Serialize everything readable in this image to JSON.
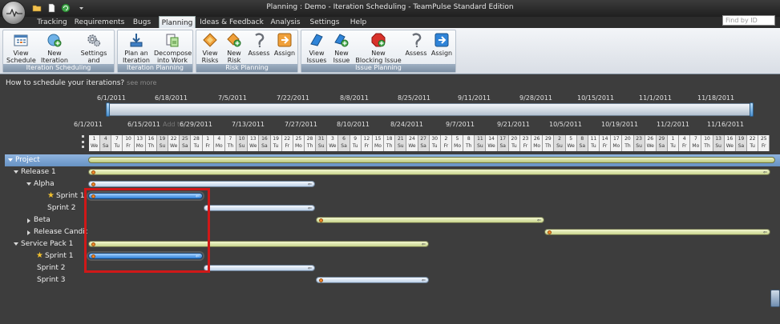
{
  "window": {
    "title": "Planning : Demo - Iteration Scheduling  - TeamPulse Standard Edition",
    "find_placeholder": "Find by ID"
  },
  "tabs": [
    {
      "label": "Tracking"
    },
    {
      "label": "Requirements"
    },
    {
      "label": "Bugs"
    },
    {
      "label": "Planning",
      "active": true
    },
    {
      "label": "Ideas & Feedback"
    },
    {
      "label": "Analysis"
    },
    {
      "label": "Settings"
    },
    {
      "label": "Help"
    }
  ],
  "ribbon": {
    "groups": [
      {
        "label": "Iteration Scheduling",
        "buttons": [
          {
            "line1": "View",
            "line2": "Schedule",
            "icon": "calendar-icon"
          },
          {
            "line1": "New",
            "line2": "Iteration",
            "icon": "add-iteration-icon"
          },
          {
            "line1": "Settings",
            "line2": "and Defaults",
            "icon": "gears-icon"
          }
        ]
      },
      {
        "label": "Iteration Planning",
        "buttons": [
          {
            "line1": "Plan an",
            "line2": "Iteration",
            "icon": "download-tray-icon"
          },
          {
            "line1": "Decompose",
            "line2": "into Work",
            "icon": "decompose-icon"
          }
        ]
      },
      {
        "label": "Risk Planning",
        "buttons": [
          {
            "line1": "View",
            "line2": "Risks",
            "icon": "risk-diamond-icon"
          },
          {
            "line1": "New",
            "line2": "Risk",
            "icon": "new-risk-icon"
          },
          {
            "line1": "Assess",
            "line2": "",
            "icon": "assess-icon"
          },
          {
            "line1": "Assign",
            "line2": "",
            "icon": "assign-arrow-icon"
          }
        ]
      },
      {
        "label": "Issue Planning",
        "buttons": [
          {
            "line1": "View",
            "line2": "Issues",
            "icon": "issues-flag-icon"
          },
          {
            "line1": "New",
            "line2": "Issue",
            "icon": "new-issue-icon"
          },
          {
            "line1": "New",
            "line2": "Blocking Issue",
            "icon": "stop-sign-icon"
          },
          {
            "line1": "Assess",
            "line2": "",
            "icon": "assess-icon"
          },
          {
            "line1": "Assign",
            "line2": "",
            "icon": "assign-arrow-icon"
          }
        ]
      }
    ]
  },
  "schedule": {
    "howto": "How to schedule your iterations?",
    "see_more": "see more",
    "overview_dates": [
      "6/1/2011",
      "6/18/2011",
      "7/5/2011",
      "7/22/2011",
      "8/8/2011",
      "8/25/2011",
      "9/11/2011",
      "9/28/2011",
      "10/15/2011",
      "11/1/2011",
      "11/18/2011"
    ],
    "timeline_dates": [
      "6/1/2011",
      "6/15/2011",
      "6/29/2011",
      "7/13/2011",
      "7/27/2011",
      "8/10/2011",
      "8/24/2011",
      "9/7/2011",
      "9/21/2011",
      "10/5/2011",
      "10/19/2011",
      "11/2/2011",
      "11/16/2011"
    ],
    "ghost_text": "Add to",
    "days": [
      {
        "n": "1",
        "d": "We"
      },
      {
        "n": "4",
        "d": "Sa"
      },
      {
        "n": "7",
        "d": "Tu"
      },
      {
        "n": "10",
        "d": "Fr"
      },
      {
        "n": "13",
        "d": "Mo"
      },
      {
        "n": "16",
        "d": "Th"
      },
      {
        "n": "19",
        "d": "Su"
      },
      {
        "n": "22",
        "d": "We"
      },
      {
        "n": "25",
        "d": "Sa"
      },
      {
        "n": "28",
        "d": "Tu"
      },
      {
        "n": "1",
        "d": "Fr"
      },
      {
        "n": "4",
        "d": "Mo"
      },
      {
        "n": "7",
        "d": "Th"
      },
      {
        "n": "10",
        "d": "Su"
      },
      {
        "n": "13",
        "d": "We"
      },
      {
        "n": "16",
        "d": "Sa"
      },
      {
        "n": "19",
        "d": "Tu"
      },
      {
        "n": "22",
        "d": "Fr"
      },
      {
        "n": "25",
        "d": "Mo"
      },
      {
        "n": "28",
        "d": "Th"
      },
      {
        "n": "31",
        "d": "Su"
      },
      {
        "n": "3",
        "d": "We"
      },
      {
        "n": "6",
        "d": "Sa"
      },
      {
        "n": "9",
        "d": "Tu"
      },
      {
        "n": "12",
        "d": "Fr"
      },
      {
        "n": "15",
        "d": "Mo"
      },
      {
        "n": "18",
        "d": "Th"
      },
      {
        "n": "21",
        "d": "Su"
      },
      {
        "n": "24",
        "d": "We"
      },
      {
        "n": "27",
        "d": "Sa"
      },
      {
        "n": "30",
        "d": "Tu"
      },
      {
        "n": "2",
        "d": "Fr"
      },
      {
        "n": "5",
        "d": "Mo"
      },
      {
        "n": "8",
        "d": "Th"
      },
      {
        "n": "11",
        "d": "Su"
      },
      {
        "n": "14",
        "d": "We"
      },
      {
        "n": "17",
        "d": "Sa"
      },
      {
        "n": "20",
        "d": "Tu"
      },
      {
        "n": "23",
        "d": "Fr"
      },
      {
        "n": "26",
        "d": "Mo"
      },
      {
        "n": "29",
        "d": "Th"
      },
      {
        "n": "2",
        "d": "Su"
      },
      {
        "n": "5",
        "d": "We"
      },
      {
        "n": "8",
        "d": "Sa"
      },
      {
        "n": "11",
        "d": "Tu"
      },
      {
        "n": "14",
        "d": "Fr"
      },
      {
        "n": "17",
        "d": "Mo"
      },
      {
        "n": "20",
        "d": "Th"
      },
      {
        "n": "23",
        "d": "Su"
      },
      {
        "n": "26",
        "d": "We"
      },
      {
        "n": "29",
        "d": "Sa"
      },
      {
        "n": "1",
        "d": "Tu"
      },
      {
        "n": "4",
        "d": "Fr"
      },
      {
        "n": "7",
        "d": "Mo"
      },
      {
        "n": "10",
        "d": "Th"
      },
      {
        "n": "13",
        "d": "Su"
      },
      {
        "n": "16",
        "d": "We"
      },
      {
        "n": "19",
        "d": "Sa"
      },
      {
        "n": "22",
        "d": "Tu"
      },
      {
        "n": "25",
        "d": "Fr"
      }
    ],
    "rows": [
      {
        "label": "Project",
        "type": "project"
      },
      {
        "label": "Release 1",
        "type": "release",
        "expanded": true
      },
      {
        "label": "Alpha",
        "type": "group",
        "expanded": true
      },
      {
        "label": "Sprint 1",
        "type": "sprint",
        "current": true
      },
      {
        "label": "Sprint 2",
        "type": "sprint"
      },
      {
        "label": "Beta",
        "type": "group",
        "expanded": false
      },
      {
        "label": "Release Candid",
        "type": "group",
        "expanded": false
      },
      {
        "label": "Service Pack 1",
        "type": "release",
        "expanded": true
      },
      {
        "label": "Sprint 1",
        "type": "sprint",
        "current": true
      },
      {
        "label": "Sprint 2",
        "type": "sprint"
      },
      {
        "label": "Sprint 3",
        "type": "sprint"
      }
    ]
  }
}
